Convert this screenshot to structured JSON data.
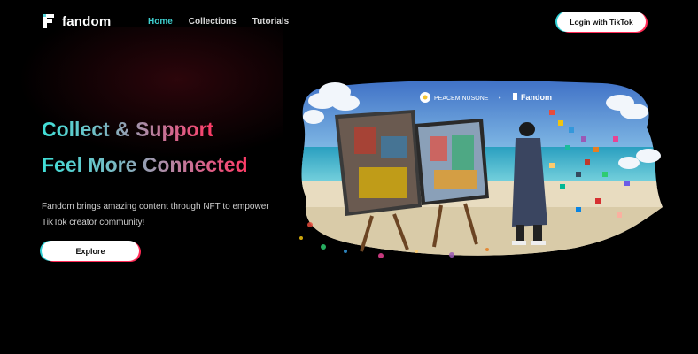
{
  "brand": {
    "name": "fandom"
  },
  "nav": {
    "items": [
      {
        "label": "Home",
        "active": true
      },
      {
        "label": "Collections",
        "active": false
      },
      {
        "label": "Tutorials",
        "active": false
      }
    ]
  },
  "header": {
    "login_label": "Login with TikTok"
  },
  "hero": {
    "headline_1": "Collect & Support",
    "headline_2": "Feel More Connected",
    "description": "Fandom brings amazing content through NFT to empower TikTok creator community!",
    "cta_label": "Explore"
  },
  "artwork": {
    "partner_name": "PEACEMINUSONE",
    "brand_name": "Fandom",
    "separator": "•"
  },
  "colors": {
    "background": "#000000",
    "accent_teal": "#3fd0d0",
    "accent_pink": "#ff2a55",
    "nav_text": "#d8d8d8"
  }
}
